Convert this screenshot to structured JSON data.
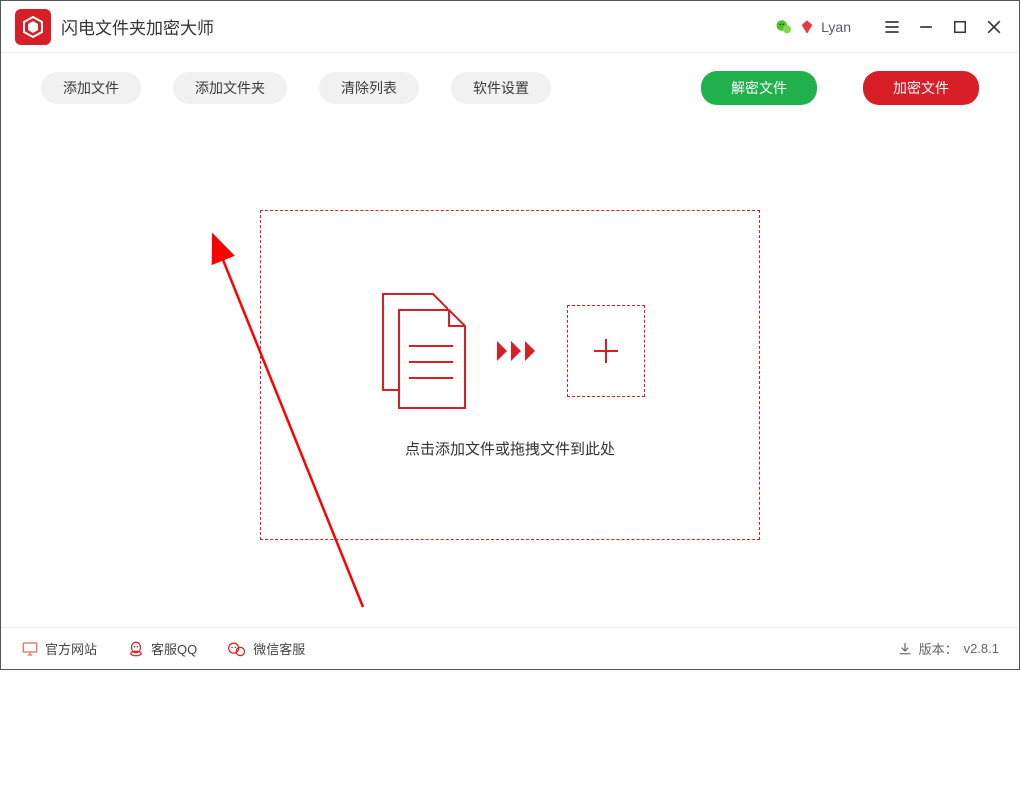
{
  "app": {
    "title": "闪电文件夹加密大师",
    "user": "Lyan"
  },
  "toolbar": {
    "add_file": "添加文件",
    "add_folder": "添加文件夹",
    "clear_list": "清除列表",
    "settings": "软件设置",
    "decrypt": "解密文件",
    "encrypt": "加密文件"
  },
  "dropzone": {
    "hint": "点击添加文件或拖拽文件到此处"
  },
  "statusbar": {
    "website": "官方网站",
    "qq": "客服QQ",
    "wechat": "微信客服",
    "version_label": "版本：",
    "version": "v2.8.1"
  },
  "colors": {
    "brand_red": "#d81e27",
    "brand_green": "#21b14c"
  }
}
